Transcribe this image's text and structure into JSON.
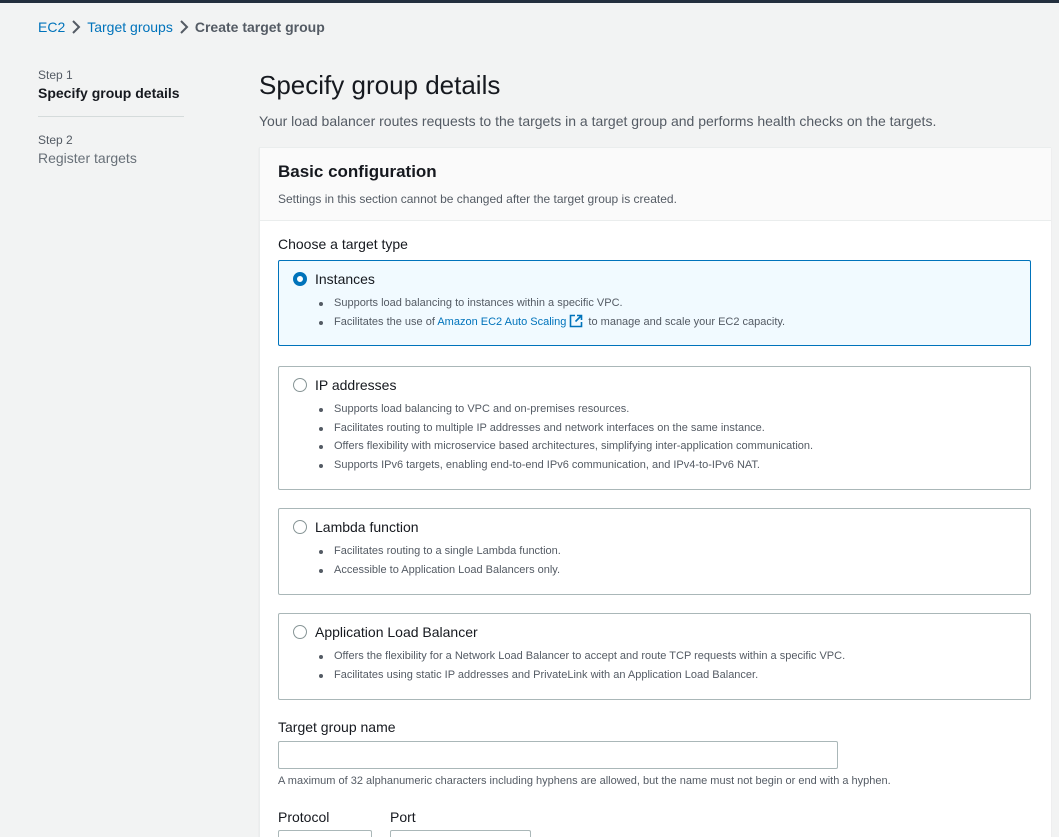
{
  "breadcrumb": {
    "items": [
      "EC2",
      "Target groups"
    ],
    "current": "Create target group"
  },
  "steps": [
    {
      "label": "Step 1",
      "title": "Specify group details"
    },
    {
      "label": "Step 2",
      "title": "Register targets"
    }
  ],
  "page": {
    "title": "Specify group details",
    "description": "Your load balancer routes requests to the targets in a target group and performs health checks on the targets."
  },
  "panel": {
    "title": "Basic configuration",
    "subtitle": "Settings in this section cannot be changed after the target group is created."
  },
  "target_type": {
    "label": "Choose a target type",
    "selected": "Instances",
    "options": [
      {
        "title": "Instances",
        "bullets": [
          "Supports load balancing to instances within a specific VPC."
        ],
        "link_bullet": {
          "prefix": "Facilitates the use of ",
          "link": "Amazon EC2 Auto Scaling",
          "suffix": " to manage and scale your EC2 capacity."
        }
      },
      {
        "title": "IP addresses",
        "bullets": [
          "Supports load balancing to VPC and on-premises resources.",
          "Facilitates routing to multiple IP addresses and network interfaces on the same instance.",
          "Offers flexibility with microservice based architectures, simplifying inter-application communication.",
          "Supports IPv6 targets, enabling end-to-end IPv6 communication, and IPv4-to-IPv6 NAT."
        ]
      },
      {
        "title": "Lambda function",
        "bullets": [
          "Facilitates routing to a single Lambda function.",
          "Accessible to Application Load Balancers only."
        ]
      },
      {
        "title": "Application Load Balancer",
        "bullets": [
          "Offers the flexibility for a Network Load Balancer to accept and route TCP requests within a specific VPC.",
          "Facilitates using static IP addresses and PrivateLink with an Application Load Balancer."
        ]
      }
    ]
  },
  "name_field": {
    "label": "Target group name",
    "value": "",
    "hint": "A maximum of 32 alphanumeric characters including hyphens are allowed, but the name must not begin or end with a hyphen."
  },
  "protocol": {
    "label": "Protocol"
  },
  "port": {
    "label": "Port"
  },
  "icons": {
    "breadcrumb_separator": "chevron-right-icon",
    "external_link": "external-link-icon"
  },
  "colors": {
    "link": "#0073bb",
    "selected_border": "#0073bb",
    "selected_bg": "#f1faff",
    "page_bg": "#f2f3f3"
  }
}
